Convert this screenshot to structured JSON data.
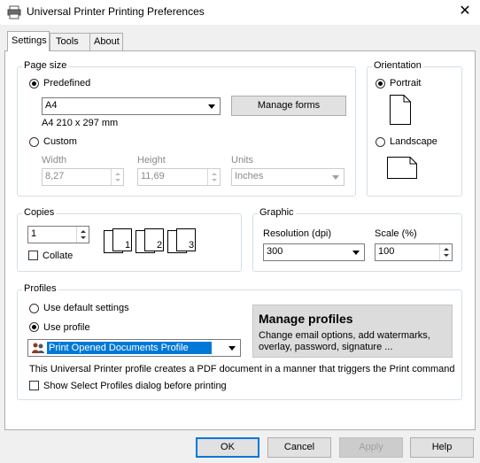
{
  "window": {
    "title": "Universal Printer Printing Preferences",
    "close_glyph": "✕"
  },
  "tabs": [
    "Settings",
    "Tools",
    "About"
  ],
  "page_size": {
    "group_label": "Page size",
    "predefined_label": "Predefined",
    "predefined_selected": true,
    "paper_value": "A4",
    "paper_dims": "A4 210 x 297 mm",
    "manage_forms_label": "Manage forms",
    "custom_label": "Custom",
    "width_label": "Width",
    "width_value": "8,27",
    "height_label": "Height",
    "height_value": "11,69",
    "units_label": "Units",
    "units_value": "Inches"
  },
  "orientation": {
    "group_label": "Orientation",
    "portrait_label": "Portrait",
    "landscape_label": "Landscape",
    "selected": "Portrait"
  },
  "copies": {
    "group_label": "Copies",
    "value": "1",
    "collate_label": "Collate",
    "collate_checked": false,
    "preview_numbers": [
      "1",
      "1",
      "2",
      "2",
      "3",
      "3"
    ]
  },
  "graphic": {
    "group_label": "Graphic",
    "resolution_label": "Resolution (dpi)",
    "resolution_value": "300",
    "scale_label": "Scale (%)",
    "scale_value": "100"
  },
  "profiles": {
    "group_label": "Profiles",
    "use_default_label": "Use default settings",
    "use_profile_label": "Use profile",
    "selected": "Use profile",
    "profile_value": "Print Opened Documents Profile",
    "description": "This Universal Printer profile creates a PDF document in a manner that triggers the Print command",
    "show_dialog_label": "Show Select Profiles dialog before printing",
    "show_dialog_checked": false,
    "promo_title": "Manage profiles",
    "promo_text": "Change email options, add watermarks, overlay, password, signature ..."
  },
  "footer": {
    "ok": "OK",
    "cancel": "Cancel",
    "apply": "Apply",
    "help": "Help"
  },
  "colors": {
    "selection": "#0078d7",
    "default_button_border": "#0078d7",
    "promo_bg": "#dcdcdc"
  },
  "icons": [
    "printer-icon",
    "close-icon",
    "profile-people-icon"
  ]
}
